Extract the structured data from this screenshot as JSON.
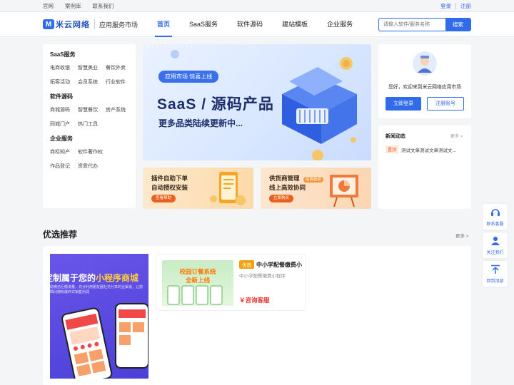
{
  "topbar": {
    "links": [
      "官网",
      "案例库",
      "联系我们"
    ],
    "login": "登录",
    "register": "注册"
  },
  "header": {
    "logo_text": "米云网络",
    "logo_letter": "M",
    "subtitle": "应用服务市场",
    "nav": [
      "首页",
      "SaaS服务",
      "软件源码",
      "建站模板",
      "企业服务"
    ],
    "search_placeholder": "请输入软件/服务名称",
    "search_button": "搜索"
  },
  "sidebar": {
    "groups": [
      {
        "title": "SaaS服务",
        "items": [
          "电商收银",
          "智慧美业",
          "餐饮外卖",
          "拓客活动",
          "会员系统",
          "行业软件"
        ]
      },
      {
        "title": "软件源码",
        "items": [
          "商城源码",
          "智慧餐饮",
          "房产系统",
          "同城门户",
          "热门工具"
        ]
      },
      {
        "title": "企业服务",
        "items": [
          "商标知产",
          "软件著作权",
          "作品登记",
          "资质代办"
        ]
      }
    ]
  },
  "banner": {
    "tag": "应用市场 惊喜上线",
    "headline": "SaaS / 源码产品",
    "subline": "更多品类陆续更新中..."
  },
  "promos": [
    {
      "line1": "插件自助下单",
      "line2": "自动授权安装",
      "button": "查看帮助"
    },
    {
      "line1": "供货商管理",
      "line2": "线上高效协同",
      "badge": "招商投资",
      "button": "立即购买"
    }
  ],
  "login_card": {
    "welcome": "您好，欢迎来到米云网络应用市场",
    "login": "立即登录",
    "register": "注册账号"
  },
  "news": {
    "title": "新闻动态",
    "more": "更多 >",
    "items": [
      {
        "tag": "置顶",
        "text": "测试文章测试文章测试文..."
      }
    ]
  },
  "recommend": {
    "title": "优选推荐",
    "more": "更多 >",
    "hero": {
      "headline_a": "定制属于您的",
      "headline_b": "小程序商城",
      "desc": "助微信巨额流量，充分利用朋友圈社交分享的业渠道，让您瞬间拥有爆炸式销售利润"
    },
    "items": [
      {
        "badge": "优选",
        "name": "中小学配餐缴费小",
        "subtitle": "中小学配餐缴费小程序",
        "thumb_line1": "校园订餐系统",
        "thumb_line2": "全新上线",
        "price": "￥咨询客服"
      }
    ]
  },
  "floating": [
    {
      "label": "联系客服"
    },
    {
      "label": "关注我们"
    },
    {
      "label": "回到顶部"
    }
  ],
  "colors": {
    "primary": "#2f6bea",
    "accent": "#e9611e",
    "price": "#e8362e"
  }
}
